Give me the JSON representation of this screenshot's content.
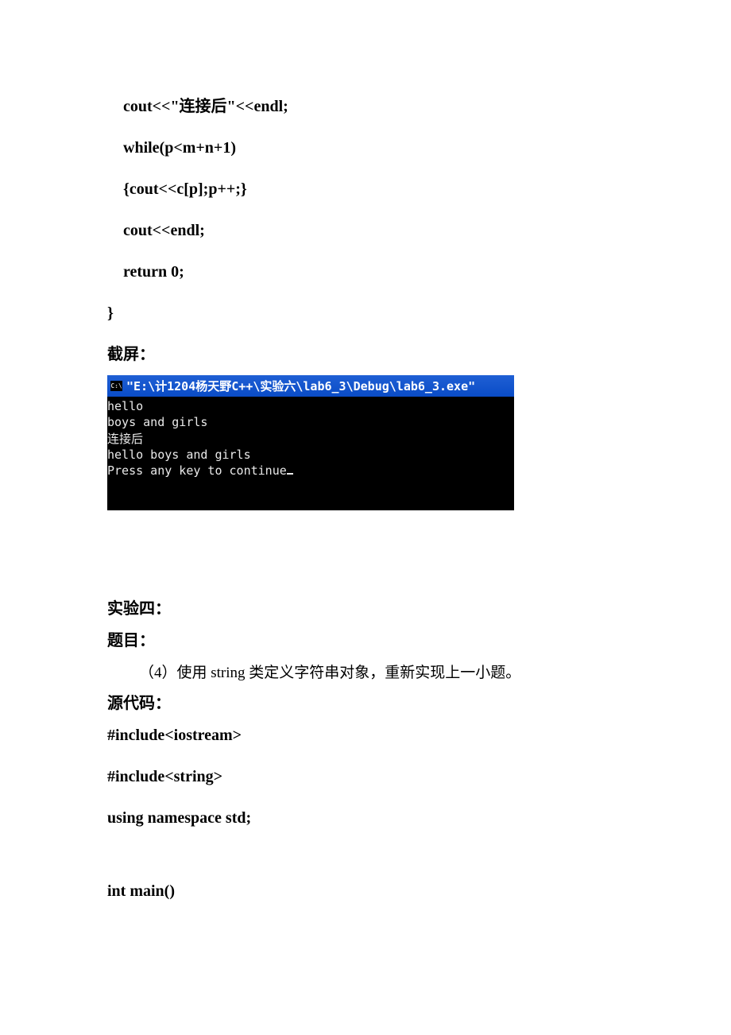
{
  "code_top": [
    "cout<<\"连接后\"<<endl;",
    "while(p<m+n+1)",
    "{cout<<c[p];p++;}",
    "cout<<endl;",
    "return 0;"
  ],
  "brace": "}",
  "label_screenshot": "截屏：",
  "terminal": {
    "icon": "C:\\",
    "title": "\"E:\\计1204杨天野C++\\实验六\\lab6_3\\Debug\\lab6_3.exe\"",
    "lines": [
      "hello",
      "boys and girls",
      "连接后",
      "hello boys and girls",
      "Press any key to continue"
    ]
  },
  "section": {
    "title": "实验四：",
    "subject_label": "题目：",
    "subject_text": "（4）使用 string 类定义字符串对象，重新实现上一小题。",
    "source_label": "源代码："
  },
  "code_bottom": [
    "#include<iostream>",
    "#include<string>",
    "using namespace std;"
  ],
  "code_main": "int main()"
}
